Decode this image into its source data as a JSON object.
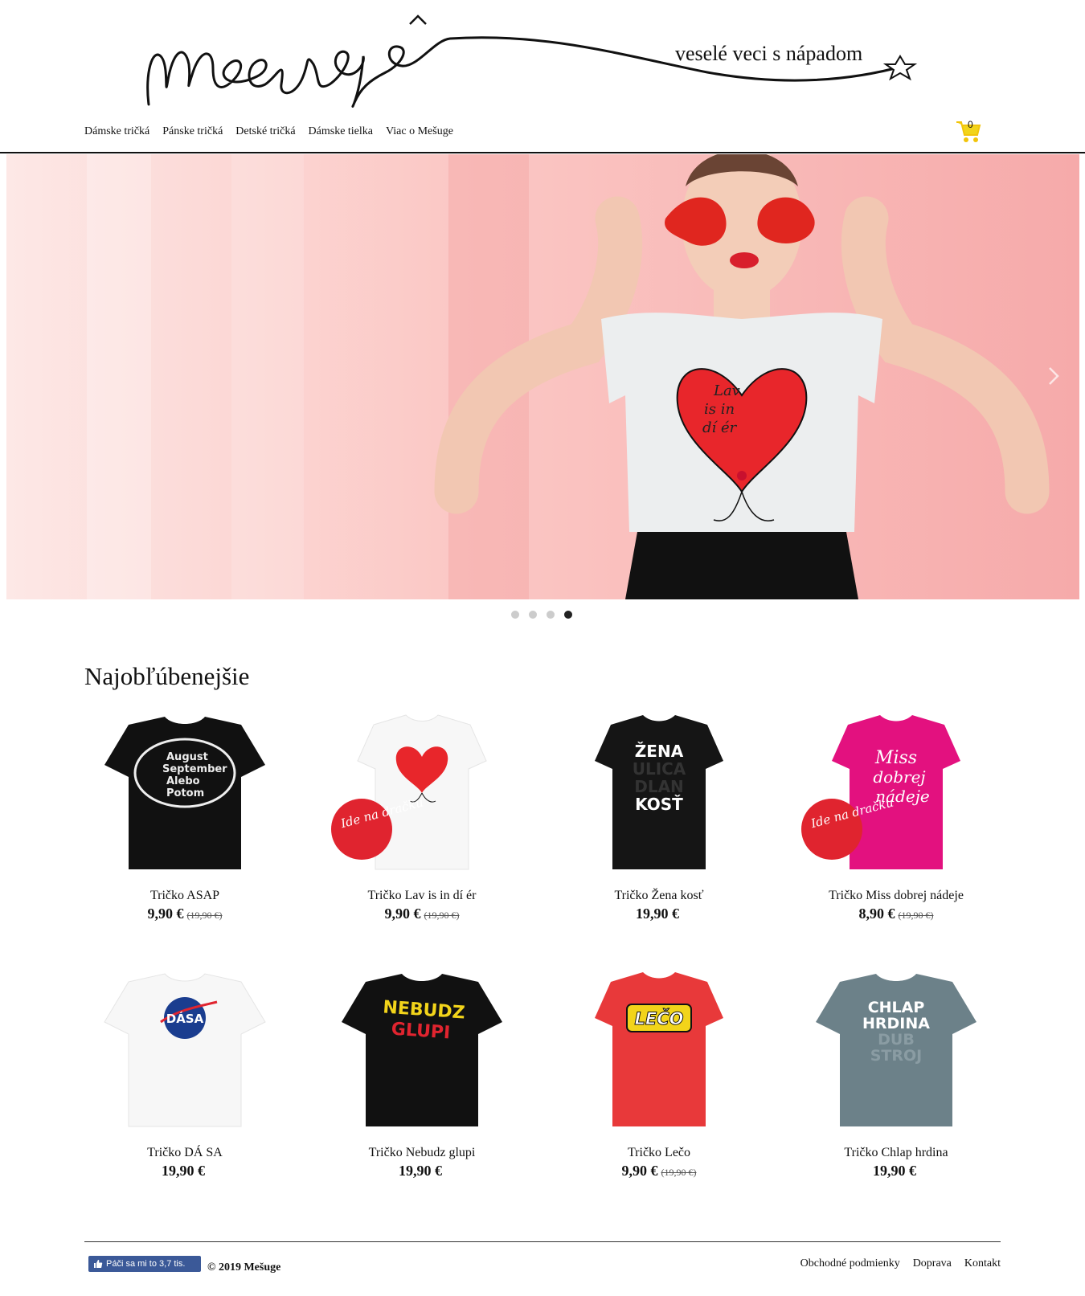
{
  "brand": {
    "logo_text": "Mešuge",
    "tagline": "veselé veci s nápadom"
  },
  "nav": [
    "Dámske tričká",
    "Pánske tričká",
    "Detské tričká",
    "Dámske tielka",
    "Viac o Mešuge"
  ],
  "cart": {
    "count": "0"
  },
  "hero": {
    "shirt_text": [
      "Lav",
      "is in",
      "dí ér"
    ],
    "active_slide": 4,
    "slides": 4
  },
  "section": {
    "title": "Najobľúbenejšie"
  },
  "badge_text": "Ide na dračku",
  "products": [
    {
      "name": "Tričko ASAP",
      "price": "9,90 €",
      "old_price": "(19,90 €)",
      "shirt_color": "#111111",
      "print": [
        "August",
        "September",
        "Alebo",
        "Potom"
      ]
    },
    {
      "name": "Tričko Lav is in dí ér",
      "price": "9,90 €",
      "old_price": "(19,90 €)",
      "shirt_color": "#ffffff",
      "badge": true
    },
    {
      "name": "Tričko Žena kosť",
      "price": "19,90 €",
      "old_price": "",
      "shirt_color": "#151515",
      "print": [
        "ŽENA",
        "ULICA",
        "DLAN",
        "KOSŤ"
      ]
    },
    {
      "name": "Tričko Miss dobrej nádeje",
      "price": "8,90 €",
      "old_price": "(19,90 €)",
      "shirt_color": "#e3117f",
      "badge": true,
      "print": [
        "Miss",
        "dobrej",
        "nádeje"
      ]
    },
    {
      "name": "Tričko DÁ SA",
      "price": "19,90 €",
      "old_price": "",
      "shirt_color": "#ffffff",
      "print": [
        "DÁSA"
      ]
    },
    {
      "name": "Tričko Nebudz glupi",
      "price": "19,90 €",
      "old_price": "",
      "shirt_color": "#111111",
      "print": [
        "NEBUDZ",
        "GLUPI"
      ]
    },
    {
      "name": "Tričko Lečo",
      "price": "9,90 €",
      "old_price": "(19,90 €)",
      "shirt_color": "#e8393a",
      "print": [
        "LEČO"
      ]
    },
    {
      "name": "Tričko Chlap hrdina",
      "price": "19,90 €",
      "old_price": "",
      "shirt_color": "#6c8189",
      "print": [
        "CHLAP",
        "HRDINA",
        "DUB",
        "STROJ"
      ]
    }
  ],
  "footer": {
    "fb_like": "Páči sa mi to 3,7 tis.",
    "copyright": "© 2019 Mešuge",
    "links": [
      "Obchodné podmienky",
      "Doprava",
      "Kontakt"
    ]
  }
}
